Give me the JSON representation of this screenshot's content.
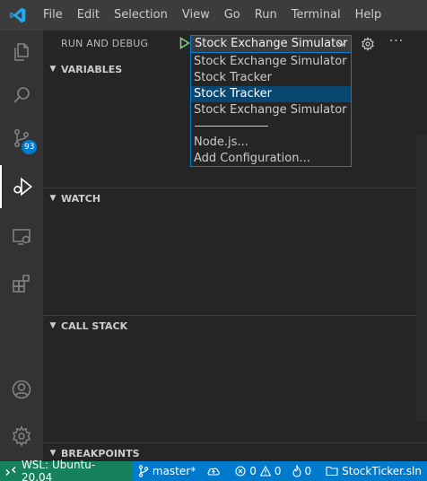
{
  "menu": [
    "File",
    "Edit",
    "Selection",
    "View",
    "Go",
    "Run",
    "Terminal",
    "Help"
  ],
  "activity_bar": {
    "source_control_badge": "93"
  },
  "sidebar": {
    "title": "RUN AND DEBUG",
    "selected_configuration": "Stock Exchange Simulator",
    "sections": {
      "variables": "VARIABLES",
      "watch": "WATCH",
      "call_stack": "CALL STACK",
      "breakpoints": "BREAKPOINTS"
    }
  },
  "dropdown": {
    "items": [
      "Stock Exchange Simulator",
      "Stock Tracker",
      "Stock Tracker",
      "Stock Exchange Simulator"
    ],
    "highlighted_index": 2,
    "extra_items": [
      "Node.js...",
      "Add Configuration..."
    ]
  },
  "statusbar": {
    "remote": "WSL: Ubuntu-20.04",
    "branch": "master*",
    "errors": "0",
    "warnings": "0",
    "info": "0",
    "solution": "StockTicker.sln"
  },
  "colors": {
    "accent": "#007acc",
    "remote": "#16825d",
    "selection": "#094771",
    "vscode_blue": "#23a9f2"
  }
}
